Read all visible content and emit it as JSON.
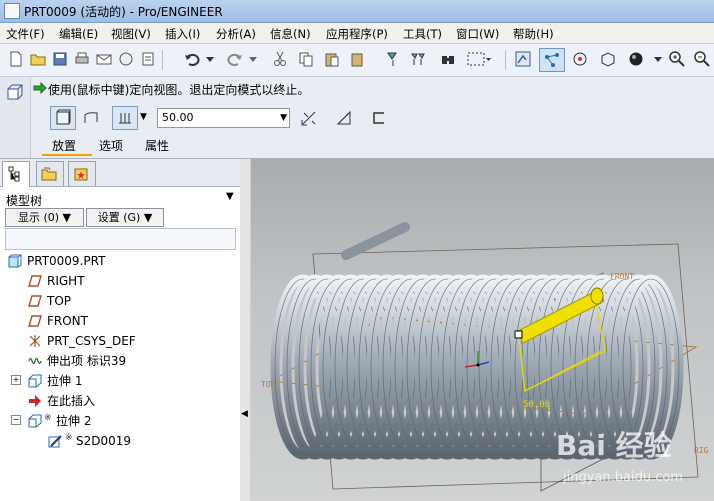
{
  "window": {
    "title": "PRT0009 (活动的) - Pro/ENGINEER"
  },
  "menu": [
    "文件(F)",
    "编辑(E)",
    "视图(V)",
    "插入(I)",
    "分析(A)",
    "信息(N)",
    "应用程序(P)",
    "工具(T)",
    "窗口(W)",
    "帮助(H)"
  ],
  "dashboard": {
    "message": "使用(鼠标中键)定向视图。退出定向模式以终止。",
    "depth_value": "50.00",
    "tabs": [
      "放置",
      "选项",
      "属性"
    ]
  },
  "model_tree": {
    "title": "模型树",
    "show_button": "显示 (0) ▼",
    "settings_button": "设置 (G) ▼",
    "items": [
      {
        "label": "PRT0009.PRT"
      },
      {
        "label": "RIGHT"
      },
      {
        "label": "TOP"
      },
      {
        "label": "FRONT"
      },
      {
        "label": "PRT_CSYS_DEF"
      },
      {
        "label": "伸出项 标识39"
      },
      {
        "label": "拉伸 1"
      },
      {
        "label": "在此插入"
      },
      {
        "label": "拉伸 2"
      },
      {
        "label": "S2D0019"
      }
    ]
  },
  "viewport": {
    "labels": {
      "front": "FRONT",
      "top": "TOP",
      "right": "RIG",
      "dim": "50.00"
    },
    "watermark": "Bai 经验",
    "watermark_url": "jingyan.baidu.com"
  },
  "colors": {
    "highlight": "#f0e000",
    "datum": "#b87a30",
    "spring": "#a9b4c0"
  }
}
